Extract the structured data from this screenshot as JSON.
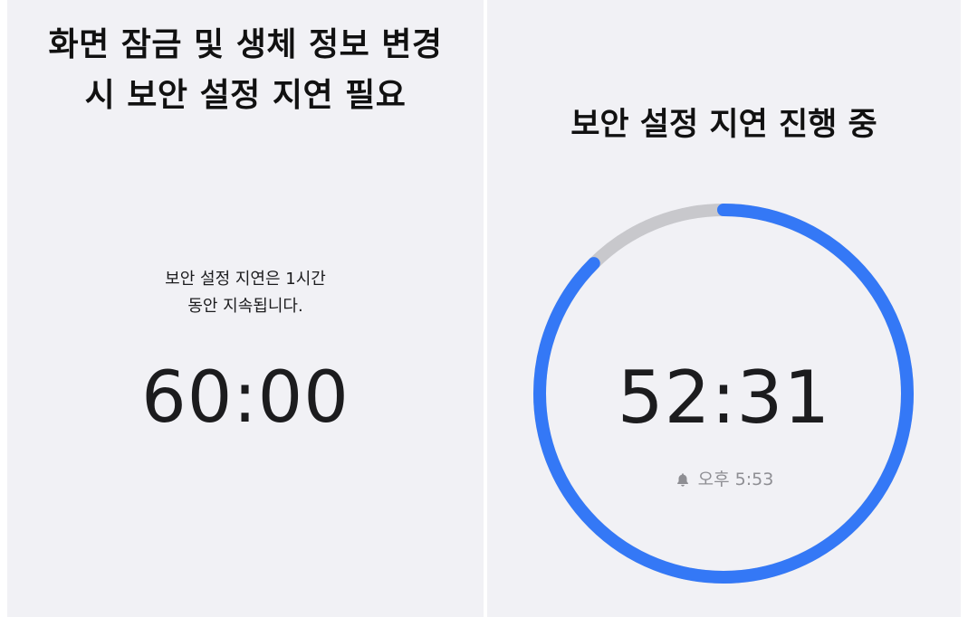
{
  "left_screen": {
    "title_line1": "화면 잠금 및 생체 정보 변경",
    "title_line2": "시 보안 설정 지연 필요",
    "description_line1": "보안 설정 지연은 1시간",
    "description_line2": "동안 지속됩니다.",
    "timer": "60:00"
  },
  "right_screen": {
    "title": "보안 설정 지연 진행 중",
    "timer": "52:31",
    "alarm_icon": "bell-icon",
    "alarm_time": "오후 5:53",
    "progress_remaining_fraction": 0.875,
    "colors": {
      "progress": "#3478f6",
      "track": "#c8c8cc"
    }
  },
  "colors": {
    "panel_background": "#f1f1f5",
    "text_primary": "#1c1c1e",
    "text_secondary": "#8e8e93"
  }
}
